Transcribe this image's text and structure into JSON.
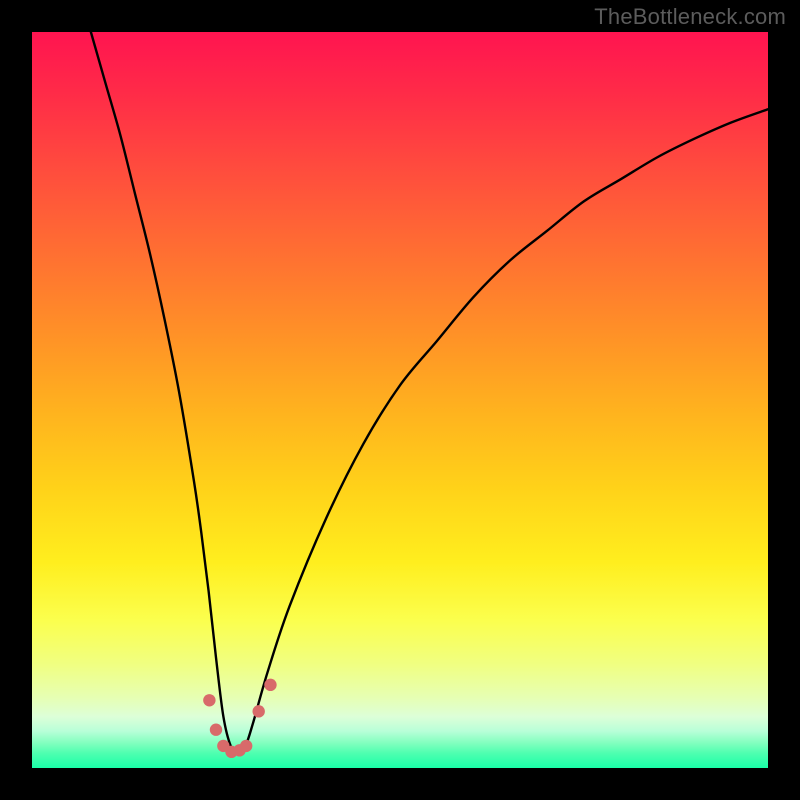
{
  "watermark": "TheBottleneck.com",
  "chart_data": {
    "type": "line",
    "title": "",
    "xlabel": "",
    "ylabel": "",
    "xlim": [
      0,
      100
    ],
    "ylim": [
      0,
      100
    ],
    "series": [
      {
        "name": "bottleneck-curve",
        "x": [
          8,
          10,
          12,
          14,
          16,
          18,
          20,
          22,
          23,
          24,
          25,
          26,
          27,
          28,
          29,
          30,
          32,
          35,
          40,
          45,
          50,
          55,
          60,
          65,
          70,
          75,
          80,
          85,
          90,
          95,
          100
        ],
        "y": [
          100,
          93,
          86,
          78,
          70,
          61,
          51,
          39,
          32,
          24,
          15,
          7,
          3,
          2,
          3,
          6,
          13,
          22,
          34,
          44,
          52,
          58,
          64,
          69,
          73,
          77,
          80,
          83,
          85.5,
          87.7,
          89.5
        ]
      }
    ],
    "markers": {
      "name": "threshold-dots",
      "color": "#d86a6a",
      "points": [
        {
          "x": 24.1,
          "y": 9.2
        },
        {
          "x": 25.0,
          "y": 5.2
        },
        {
          "x": 26.0,
          "y": 3.0
        },
        {
          "x": 27.1,
          "y": 2.2
        },
        {
          "x": 28.2,
          "y": 2.4
        },
        {
          "x": 29.1,
          "y": 3.0
        },
        {
          "x": 30.8,
          "y": 7.7
        },
        {
          "x": 32.4,
          "y": 11.3
        }
      ]
    },
    "gradient_stops": [
      {
        "pos": 0,
        "color": "#ff1450"
      },
      {
        "pos": 50,
        "color": "#ffb81e"
      },
      {
        "pos": 80,
        "color": "#faff50"
      },
      {
        "pos": 100,
        "color": "#1affa8"
      }
    ]
  }
}
